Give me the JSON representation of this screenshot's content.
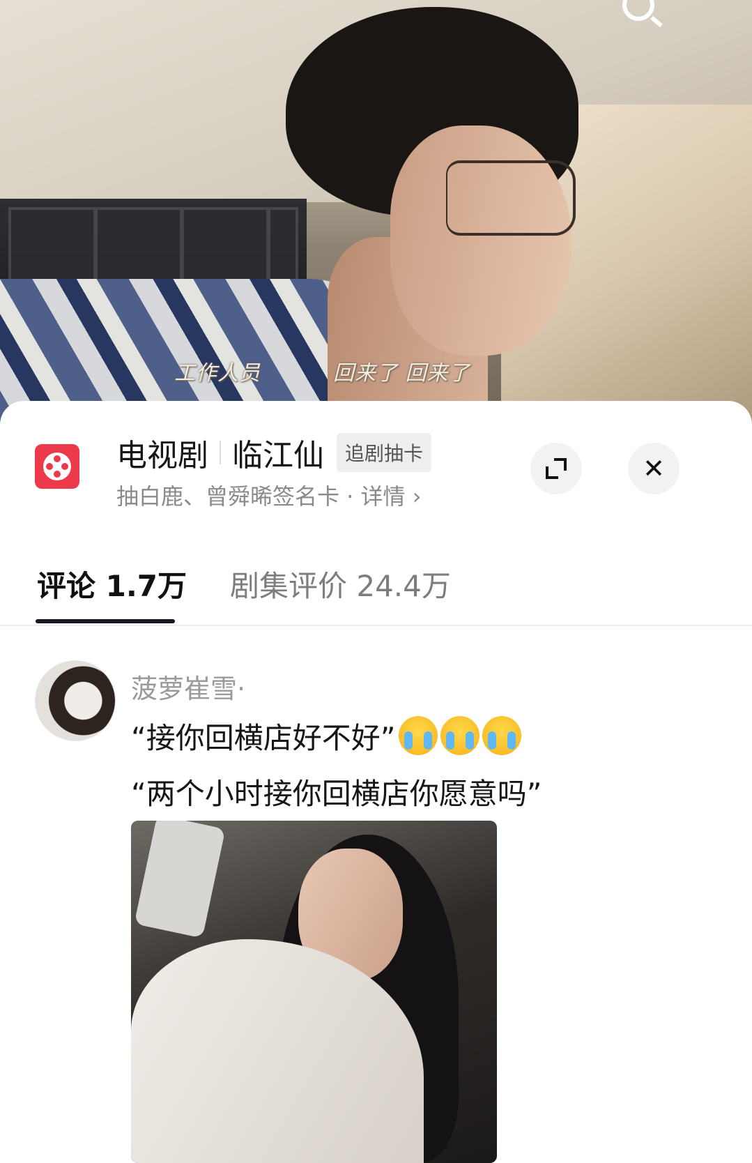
{
  "video": {
    "subtitle_left": "工作人员",
    "subtitle_right": "回来了 回来了"
  },
  "header": {
    "category": "电视剧",
    "title": "临江仙",
    "tag": "追剧抽卡",
    "subtitle": "抽白鹿、曾舜晞签名卡 · 详情 ›"
  },
  "tabs": [
    {
      "label": "评论 1.7万",
      "active": true
    },
    {
      "label": "剧集评价 24.4万",
      "active": false
    }
  ],
  "comment": {
    "username": "菠萝崔雪·",
    "line1": "“接你回横店好不好”",
    "line2": "“两个小时接你回横店你愿意吗”",
    "emoji_name": "loudly-crying-face"
  },
  "colors": {
    "brand_red": "#ed3a4a",
    "tab_active": "#161823",
    "muted_text": "#8a8a8a"
  }
}
